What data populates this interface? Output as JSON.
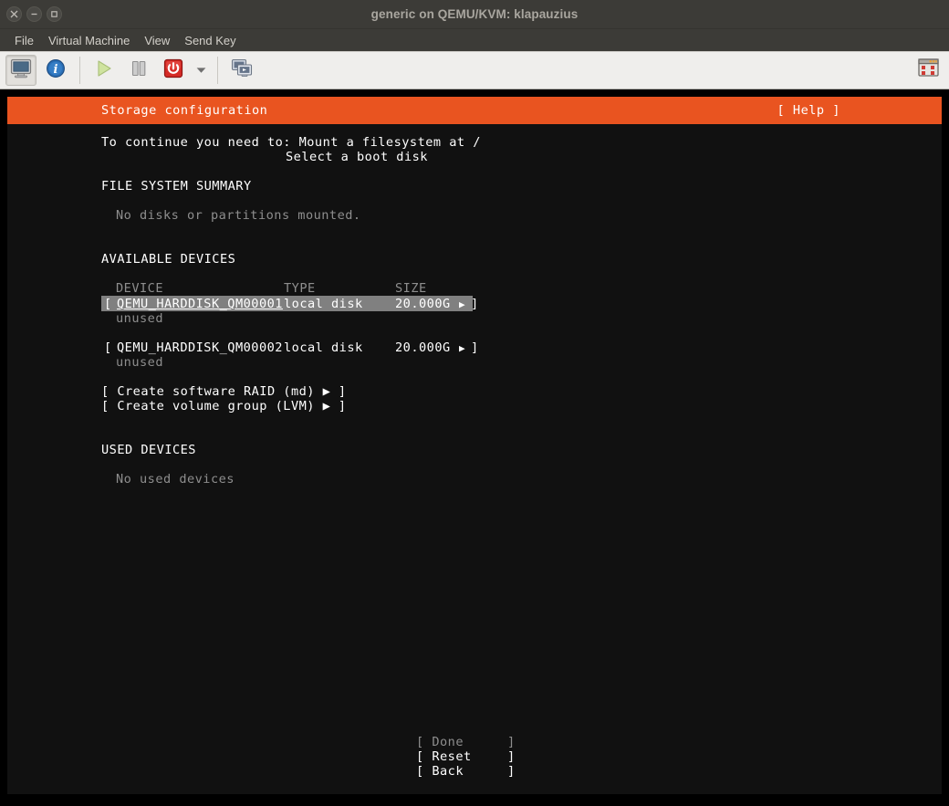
{
  "window": {
    "title": "generic on QEMU/KVM: klapauzius",
    "buttons": [
      {
        "name": "close",
        "glyph": "✕"
      },
      {
        "name": "minimize",
        "glyph": "–"
      },
      {
        "name": "maximize",
        "glyph": "□"
      }
    ]
  },
  "menubar": {
    "items": [
      {
        "label": "File"
      },
      {
        "label": "Virtual Machine"
      },
      {
        "label": "View"
      },
      {
        "label": "Send Key"
      }
    ]
  },
  "toolbar": {
    "items": [
      {
        "name": "show-console-button",
        "icon": "monitor-icon",
        "state": "pressed"
      },
      {
        "name": "show-details-button",
        "icon": "info-icon",
        "state": "normal"
      },
      {
        "name": "run-button",
        "icon": "play-icon",
        "state": "disabled"
      },
      {
        "name": "pause-button",
        "icon": "pause-icon",
        "state": "normal"
      },
      {
        "name": "shutdown-button",
        "icon": "power-icon",
        "state": "normal"
      },
      {
        "name": "shutdown-menu-button",
        "icon": "chevron-down-icon",
        "state": "normal"
      },
      {
        "name": "fullscreen-button",
        "icon": "screens-icon",
        "state": "normal"
      },
      {
        "name": "snapshots-button",
        "icon": "snapshot-icon",
        "state": "normal"
      }
    ],
    "colors": {
      "accent_orange": "#e95420",
      "power_red": "#cc2222",
      "info_blue": "#2b6fb5",
      "play_green": "#b6d77a"
    }
  },
  "terminal": {
    "header": {
      "title": "Storage configuration",
      "help": "[ Help ]"
    },
    "intro": {
      "line1": "To continue you need to: Mount a filesystem at /",
      "line2": "Select a boot disk"
    },
    "filesystem_summary": {
      "heading": "FILE SYSTEM SUMMARY",
      "message": "No disks or partitions mounted."
    },
    "available_devices": {
      "heading": "AVAILABLE DEVICES",
      "columns": {
        "device": "DEVICE",
        "type": "TYPE",
        "size": "SIZE"
      },
      "rows": [
        {
          "open_bracket": "[",
          "device": "QEMU_HARDDISK_QM00001",
          "type": "local disk",
          "size": "20.000G",
          "arrow": "▶",
          "close_bracket": "]",
          "status": "unused",
          "selected": true
        },
        {
          "open_bracket": "[",
          "device": "QEMU_HARDDISK_QM00002",
          "type": "local disk",
          "size": "20.000G",
          "arrow": "▶",
          "close_bracket": "]",
          "status": "unused",
          "selected": false
        }
      ],
      "actions": [
        {
          "label": "[ Create software RAID (md) ▶ ]"
        },
        {
          "label": "[ Create volume group (LVM) ▶ ]"
        }
      ]
    },
    "used_devices": {
      "heading": "USED DEVICES",
      "message": "No used devices"
    },
    "footer_buttons": [
      {
        "label": "[ Done",
        "close": "]",
        "enabled": false
      },
      {
        "label": "[ Reset",
        "close": "]",
        "enabled": true
      },
      {
        "label": "[ Back",
        "close": "]",
        "enabled": true
      }
    ]
  }
}
